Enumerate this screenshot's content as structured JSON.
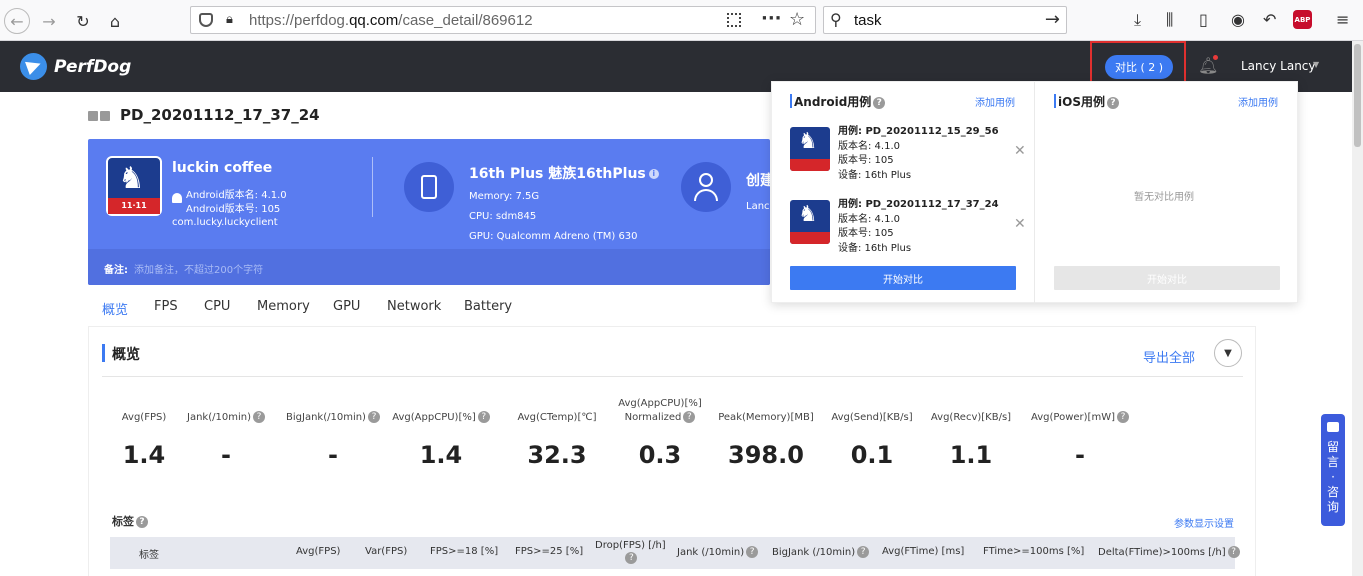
{
  "browser": {
    "url_prefix": "https://perfdog.",
    "url_domain": "qq.com",
    "url_path": "/case_detail/869612",
    "search_query": "task",
    "abp_label": "ABP"
  },
  "header": {
    "logo_text": "PerfDog",
    "compare_label": "对比 ( 2 )",
    "user_name": "Lancy Lancy"
  },
  "case": {
    "title": "PD_20201112_17_37_24",
    "app_name": "luckin coffee",
    "version_name": "Android版本名: 4.1.0",
    "version_code": "Android版本号: 105",
    "package": "com.lucky.luckyclient",
    "icon_badge": "11·11",
    "device_name": "16th Plus 魅族16thPlus",
    "memory": "Memory: 7.5G",
    "cpu": "CPU: sdm845",
    "gpu": "GPU: Qualcomm Adreno (TM) 630",
    "creator_title": "创建",
    "creator_sub": "Lanc",
    "note_label": "备注:",
    "note_placeholder": "添加备注，不超过200个字符"
  },
  "tabs": [
    "概览",
    "FPS",
    "CPU",
    "Memory",
    "GPU",
    "Network",
    "Battery"
  ],
  "overview": {
    "title": "概览",
    "export_all": "导出全部",
    "metrics": [
      {
        "label": "Avg(FPS)",
        "label2": "",
        "help": false,
        "value": "1.4"
      },
      {
        "label": "Jank(/10min)",
        "label2": "",
        "help": true,
        "value": "-"
      },
      {
        "label": "BigJank(/10min)",
        "label2": "",
        "help": true,
        "value": "-"
      },
      {
        "label": "Avg(AppCPU)[%]",
        "label2": "",
        "help": true,
        "value": "1.4"
      },
      {
        "label": "Avg(CTemp)[℃]",
        "label2": "",
        "help": false,
        "value": "32.3"
      },
      {
        "label": "Avg(AppCPU)[%]",
        "label2": "Normalized",
        "help": true,
        "value": "0.3"
      },
      {
        "label": "Peak(Memory)[MB]",
        "label2": "",
        "help": false,
        "value": "398.0"
      },
      {
        "label": "Avg(Send)[KB/s]",
        "label2": "",
        "help": false,
        "value": "0.1"
      },
      {
        "label": "Avg(Recv)[KB/s]",
        "label2": "",
        "help": false,
        "value": "1.1"
      },
      {
        "label": "Avg(Power)[mW]",
        "label2": "",
        "help": true,
        "value": "-"
      }
    ],
    "tags_title": "标签",
    "param_settings": "参数显示设置",
    "table_headers": [
      "标签",
      "Avg(FPS)",
      "Var(FPS)",
      "FPS>=18 [%]",
      "FPS>=25 [%]",
      "Drop(FPS) [/h]",
      "Jank (/10min)",
      "BigJank (/10min)",
      "Avg(FTime) [ms]",
      "FTime>=100ms [%]",
      "Delta(FTime)>100ms [/h]"
    ]
  },
  "compare": {
    "android_title": "Android用例",
    "ios_title": "iOS用例",
    "add_case": "添加用例",
    "cases": [
      {
        "name": "用例: PD_20201112_15_29_56",
        "version_name": "版本名: 4.1.0",
        "version_code": "版本号: 105",
        "device": "设备: 16th Plus"
      },
      {
        "name": "用例: PD_20201112_17_37_24",
        "version_name": "版本名: 4.1.0",
        "version_code": "版本号: 105",
        "device": "设备: 16th Plus"
      }
    ],
    "start_compare": "开始对比",
    "ios_empty": "暂无对比用例"
  },
  "feedback": {
    "label": "留言·咨询"
  }
}
